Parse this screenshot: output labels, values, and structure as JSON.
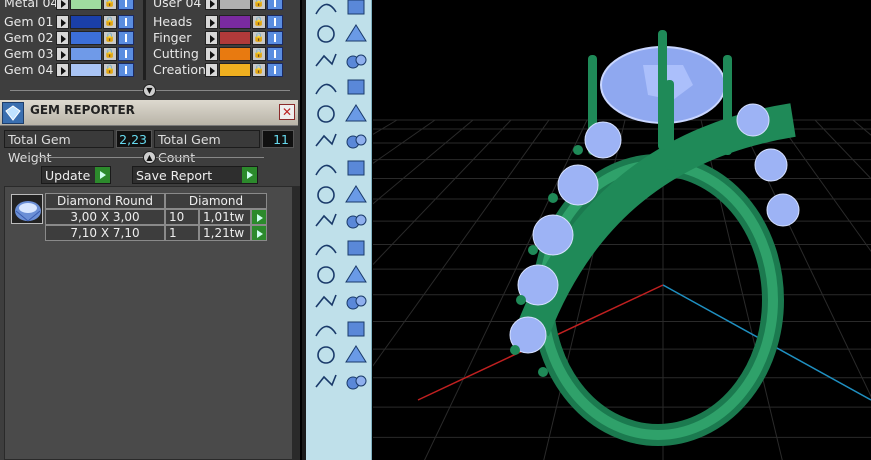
{
  "layers": {
    "left": [
      {
        "name": "Metal 04",
        "color": "#9fdc9f"
      },
      {
        "name": "Gem 01",
        "color": "#1a3fa8"
      },
      {
        "name": "Gem 02",
        "color": "#3c6fd8"
      },
      {
        "name": "Gem 03",
        "color": "#6f9ae8"
      },
      {
        "name": "Gem 04",
        "color": "#a9c4f4"
      }
    ],
    "right": [
      {
        "name": "User 04",
        "color": "#b0b0b0"
      },
      {
        "name": "Heads",
        "color": "#7a2aa0"
      },
      {
        "name": "Finger",
        "color": "#b03a3a"
      },
      {
        "name": "Cutting",
        "color": "#e87a10"
      },
      {
        "name": "Creation",
        "color": "#f0b020"
      }
    ]
  },
  "gem_reporter": {
    "title": "GEM REPORTER",
    "close_symbol": "✕",
    "total_weight_label": "Total Gem Weight",
    "total_weight_value": "2,23",
    "total_count_label": "Total Gem Count",
    "total_count_value": "11",
    "update_label": "Update",
    "save_report_label": "Save Report",
    "table": {
      "headers": [
        "Diamond Round",
        "Diamond"
      ],
      "rows": [
        {
          "size": "3,00 X 3,00",
          "count": "10",
          "weight": "1,01tw"
        },
        {
          "size": "7,10 X 7,10",
          "count": "1",
          "weight": "1,21tw"
        }
      ]
    }
  },
  "icons": {
    "logo": "gem-reporter-logo-icon",
    "thumb": "diamond-gem-icon",
    "tools": [
      "curve-tool-icon",
      "arc-tool-icon",
      "polygon-tool-icon",
      "circle-tool-icon",
      "point-curve-icon",
      "surface-icon",
      "cube-icon",
      "spheres-icon",
      "cylinder-icon",
      "plane-icon",
      "gear-icon",
      "star-burst-icon",
      "trim-icon",
      "split-icon",
      "boolean-icon",
      "group-icon",
      "rail-icon",
      "arc-rail-icon",
      "text-icon",
      "scale-icon",
      "array-icon",
      "edit-icon",
      "box-icon",
      "arrows-up-icon",
      "grid-icon",
      "align-icon",
      "gem-icon",
      "checkmark-icon",
      "shape-icon",
      "pyramid-icon"
    ]
  }
}
